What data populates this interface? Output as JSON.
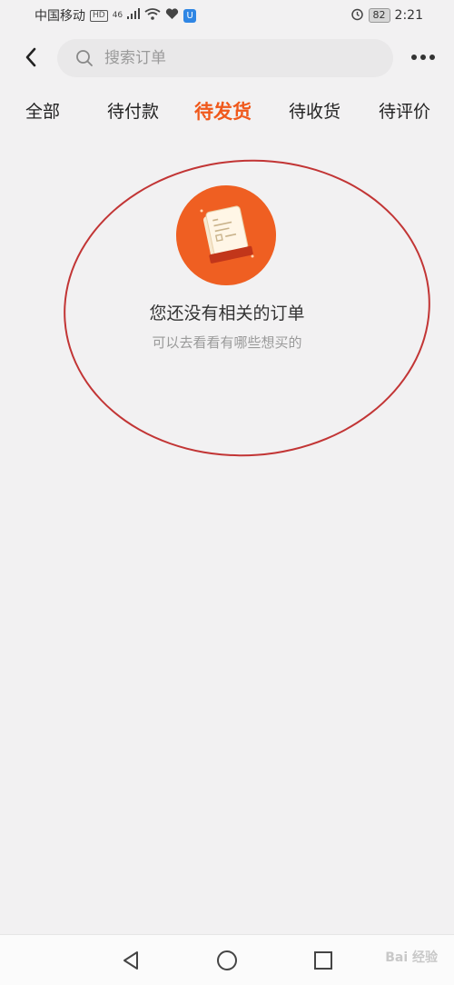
{
  "status_bar": {
    "carrier": "中国移动",
    "hd_badge": "HD",
    "network": "46",
    "shield_glyph": "U",
    "battery": "82",
    "time": "2:21"
  },
  "header": {
    "search_placeholder": "搜索订单"
  },
  "tabs": [
    {
      "label": "全部",
      "active": false
    },
    {
      "label": "待付款",
      "active": false
    },
    {
      "label": "待发货",
      "active": true
    },
    {
      "label": "待收货",
      "active": false
    },
    {
      "label": "待评价",
      "active": false
    }
  ],
  "empty_state": {
    "title": "您还没有相关的订单",
    "subtitle": "可以去看看有哪些想买的"
  },
  "watermark": "Bai 经验",
  "colors": {
    "accent": "#f0591c",
    "background": "#f2f1f2",
    "annotation_ring": "#c23535"
  }
}
